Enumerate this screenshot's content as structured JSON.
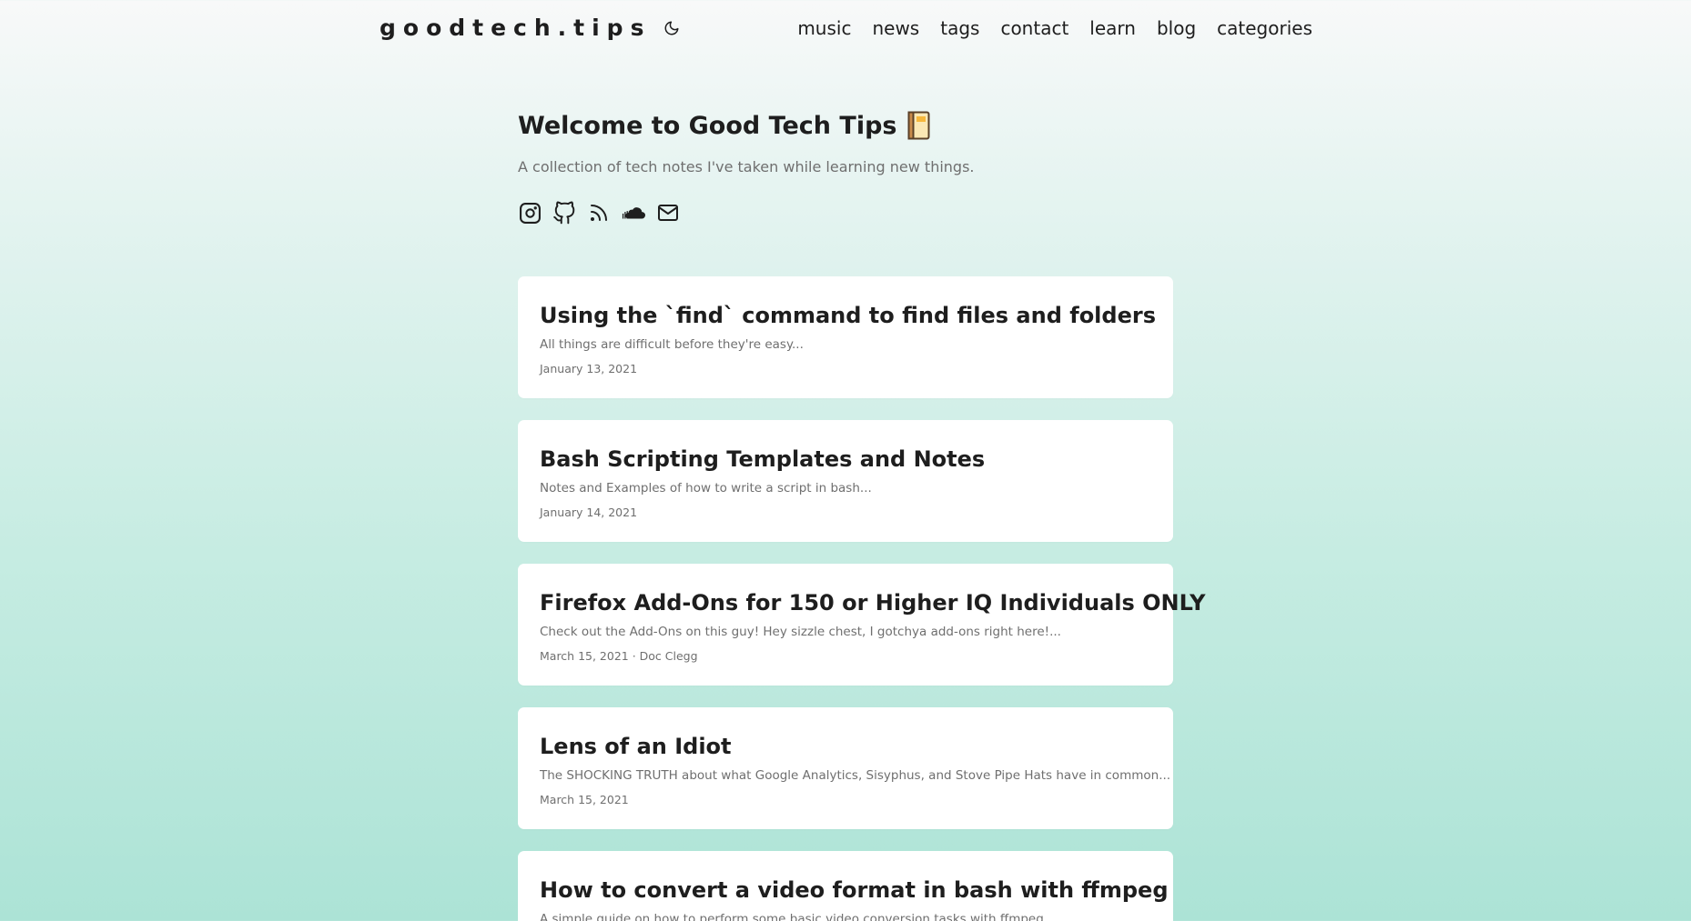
{
  "site": {
    "logo": "goodtech.tips",
    "theme_toggle_icon": "moon-icon"
  },
  "nav": {
    "items": [
      {
        "label": "music"
      },
      {
        "label": "news"
      },
      {
        "label": "tags"
      },
      {
        "label": "contact"
      },
      {
        "label": "learn"
      },
      {
        "label": "blog"
      },
      {
        "label": "categories"
      }
    ]
  },
  "intro": {
    "title": "Welcome to Good Tech Tips",
    "title_icon": "book-icon",
    "subtitle": "A collection of tech notes I've taken while learning new things."
  },
  "socials": [
    {
      "icon": "instagram-icon"
    },
    {
      "icon": "github-icon"
    },
    {
      "icon": "rss-icon"
    },
    {
      "icon": "soundcloud-icon"
    },
    {
      "icon": "email-icon"
    }
  ],
  "posts": [
    {
      "title": "Using the `find` command to find files and folders",
      "summary": "All things are difficult before they're easy...",
      "meta": "January 13, 2021"
    },
    {
      "title": "Bash Scripting Templates and Notes",
      "summary": "Notes and Examples of how to write a script in bash...",
      "meta": "January 14, 2021"
    },
    {
      "title": "Firefox Add-Ons for 150 or Higher IQ Individuals ONLY",
      "summary": "Check out the Add-Ons on this guy! Hey sizzle chest, I gotchya add-ons right here!...",
      "meta": "March 15, 2021 · Doc Clegg"
    },
    {
      "title": "Lens of an Idiot",
      "summary": "The SHOCKING TRUTH about what Google Analytics, Sisyphus, and Stove Pipe Hats have in common...",
      "meta": "March 15, 2021"
    },
    {
      "title": "How to convert a video format in bash with ffmpeg",
      "summary": "A simple guide on how to perform some basic video conversion tasks with ffmpeg...",
      "meta": ""
    }
  ]
}
